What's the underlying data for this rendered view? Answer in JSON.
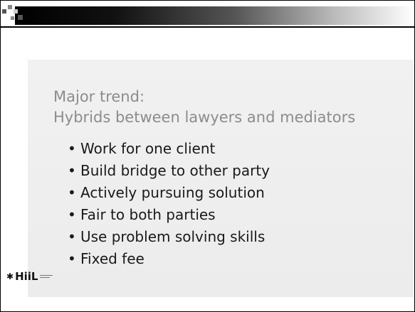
{
  "slide": {
    "title_lines": [
      "Major trend:",
      "Hybrids between lawyers and mediators"
    ],
    "bullets": [
      "Work for one client",
      "Build bridge to other party",
      "Actively pursuing solution",
      "Fair to both parties",
      "Use problem solving skills",
      "Fixed fee"
    ],
    "bullet_char": "•",
    "logo_text": "HiiL",
    "logo_mark": "✱"
  }
}
